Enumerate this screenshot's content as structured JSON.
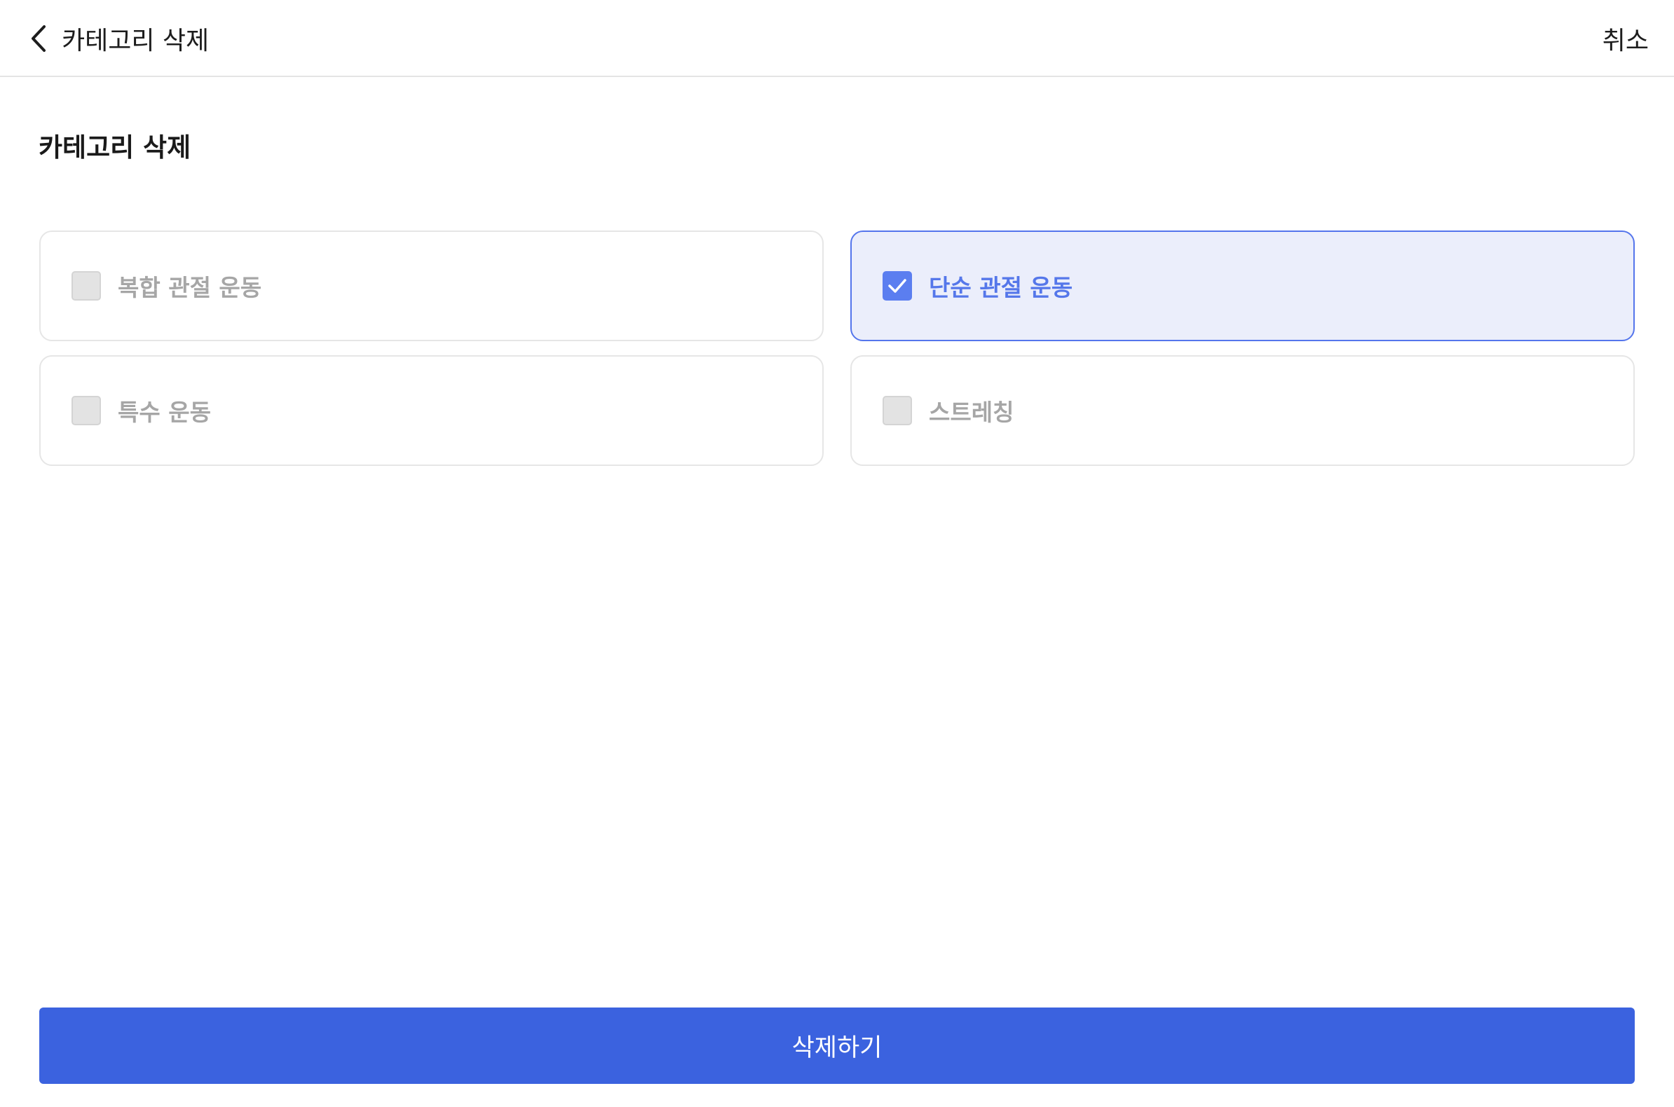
{
  "header": {
    "title": "카테고리 삭제",
    "cancel_label": "취소",
    "back_icon": "chevron-left-icon"
  },
  "main": {
    "title": "카테고리 삭제",
    "options": [
      {
        "label": "복합 관절 운동",
        "checked": false
      },
      {
        "label": "단순 관절 운동",
        "checked": true
      },
      {
        "label": "특수 운동",
        "checked": false
      },
      {
        "label": "스트레칭",
        "checked": false
      }
    ]
  },
  "footer": {
    "delete_label": "삭제하기"
  },
  "colors": {
    "accent": "#3b62df",
    "selected_bg": "#ebeefb",
    "selected_border": "#5475ec",
    "checkbox_checked": "#5b7ef0"
  }
}
